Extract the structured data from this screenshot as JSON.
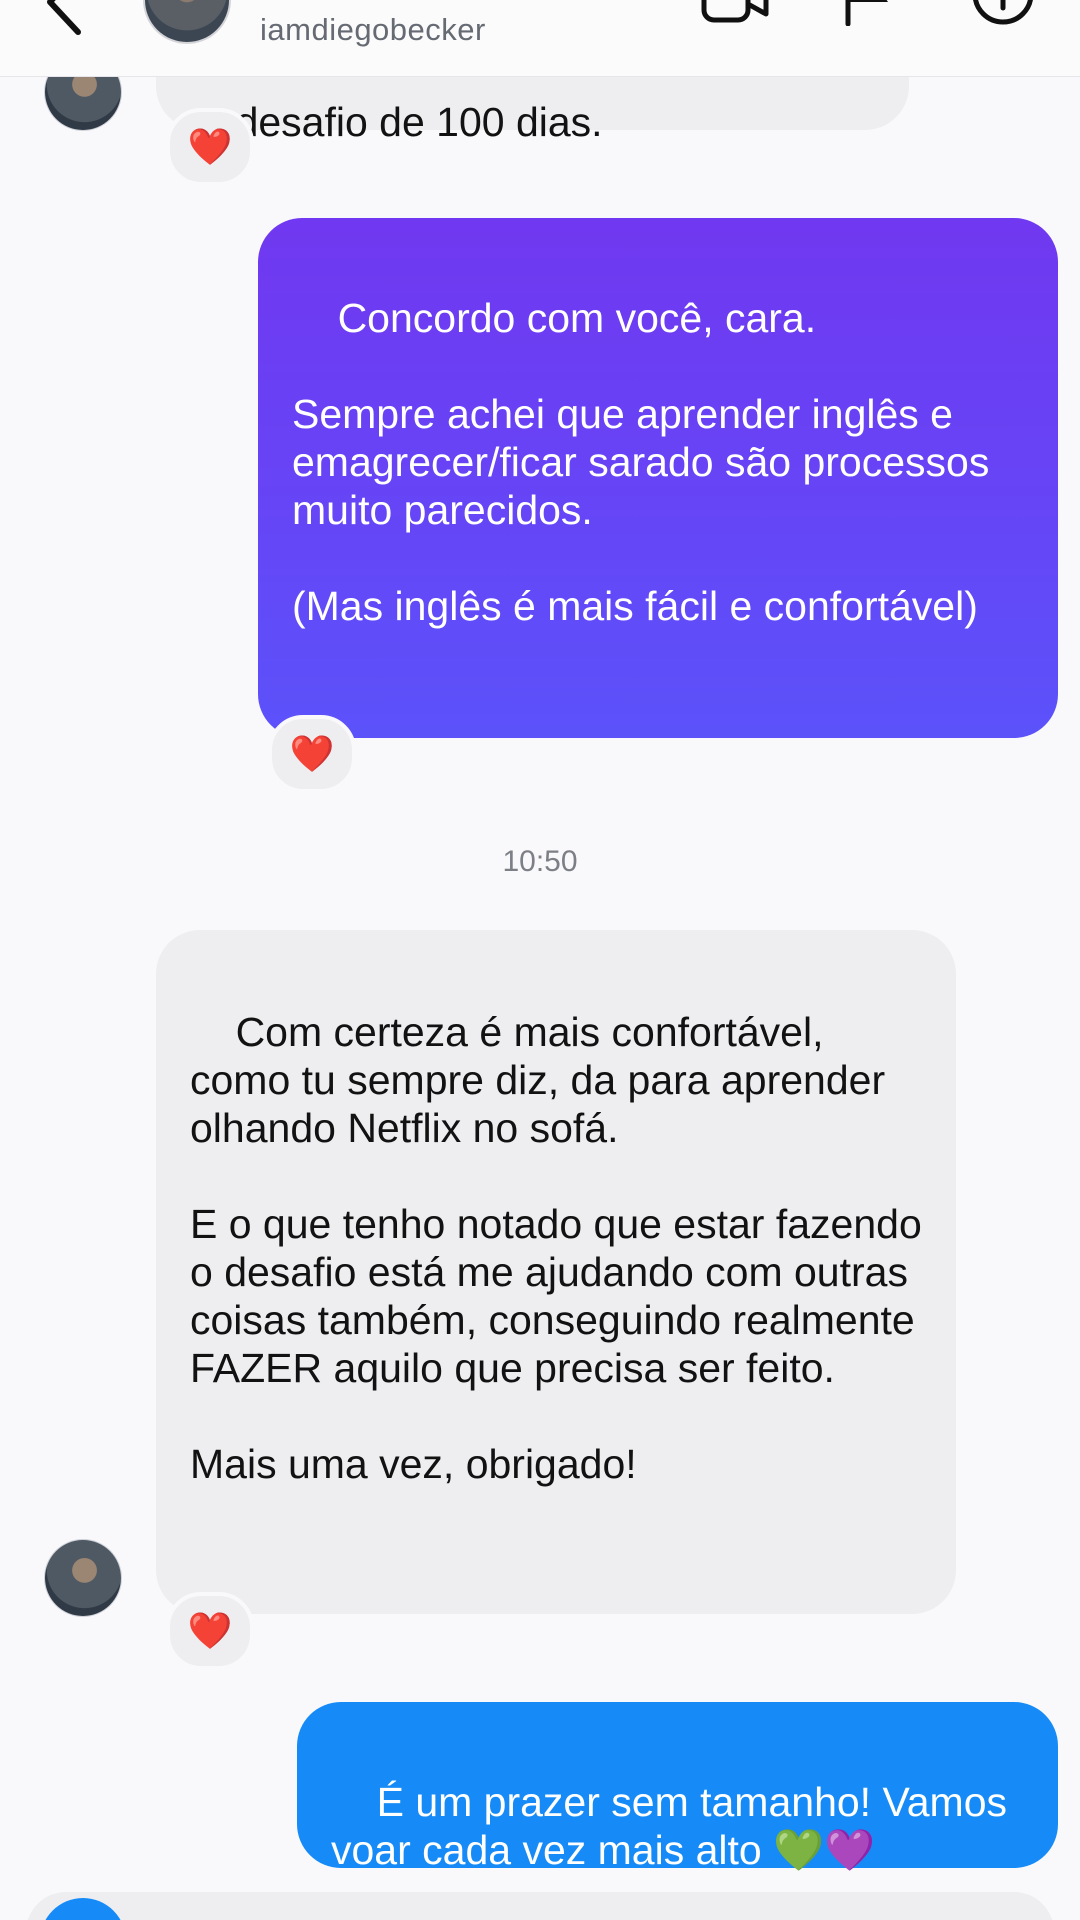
{
  "header": {
    "username": "iamdiegobecker",
    "icons": [
      "back-arrow-icon",
      "video-call-icon",
      "flag-icon",
      "info-icon"
    ]
  },
  "messages": [
    {
      "id": "msg1",
      "direction": "received",
      "text": "desafio de 100 dias.",
      "reaction": "❤️"
    },
    {
      "id": "msg2",
      "direction": "sent",
      "text": "Concordo com você, cara.\n\nSempre achei que aprender inglês e emagrecer/ficar sarado são processos muito parecidos.\n\n(Mas inglês é mais fácil e confortável)",
      "reaction": "❤️"
    },
    {
      "id": "msg3",
      "direction": "received",
      "text": "Com certeza é mais confortável, como tu sempre diz, da para aprender olhando Netflix no sofá.\n\nE o que tenho notado que estar fazendo o desafio está me ajudando com outras coisas também, conseguindo realmente FAZER aquilo que precisa ser feito.\n\nMais uma vez, obrigado!",
      "reaction": "❤️"
    },
    {
      "id": "msg4",
      "direction": "sent",
      "text": "É um prazer sem tamanho! Vamos voar cada vez mais alto 💚💜",
      "reaction": ""
    }
  ],
  "timestamp": "10:50",
  "colors": {
    "sent_purple": "#6645f6",
    "sent_blue": "#168bf7",
    "received_bubble": "#eeeef1",
    "heart": "#e8202c"
  }
}
